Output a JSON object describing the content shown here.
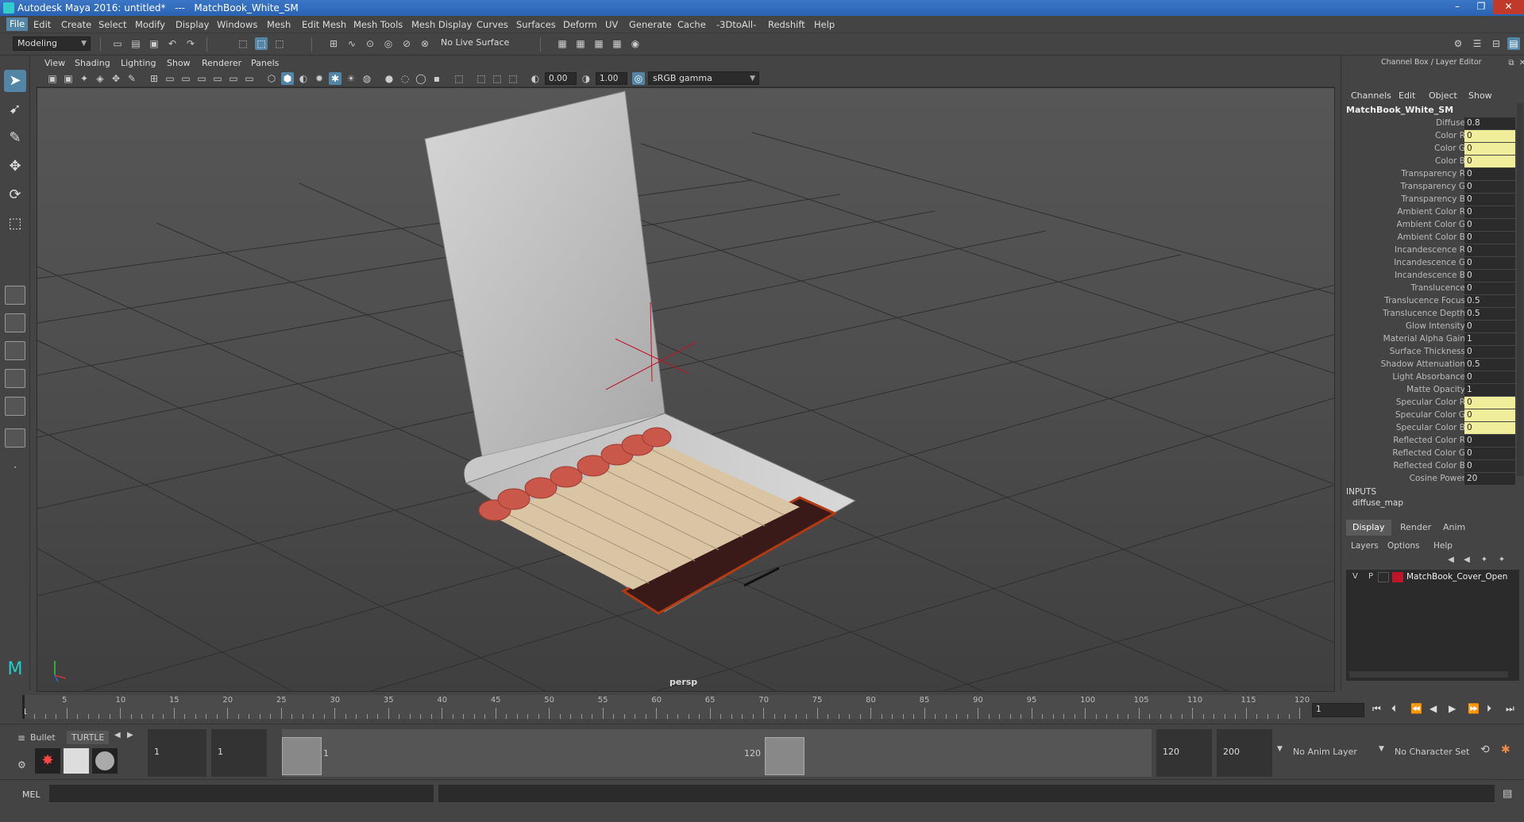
{
  "window": {
    "title": "Autodesk Maya 2016: untitled*   ---   MatchBook_White_SM",
    "min": "–",
    "max": "❐",
    "close": "✕"
  },
  "menubar": [
    "File",
    "Edit",
    "Create",
    "Select",
    "Modify",
    "Display",
    "Windows",
    "Mesh",
    "Edit Mesh",
    "Mesh Tools",
    "Mesh Display",
    "Curves",
    "Surfaces",
    "Deform",
    "UV",
    "Generate",
    "Cache",
    "-3DtoAll-",
    "Redshift",
    "Help"
  ],
  "statusline": {
    "mode": "Modeling",
    "live_surface": "No Live Surface"
  },
  "viewport": {
    "menu": [
      "View",
      "Shading",
      "Lighting",
      "Show",
      "Renderer",
      "Panels"
    ],
    "exposure": "0.00",
    "gamma": "1.00",
    "colorspace": "sRGB gamma",
    "camera": "persp"
  },
  "channelbox": {
    "title": "Channel Box / Layer Editor",
    "menu": [
      "Channels",
      "Edit",
      "Object",
      "Show"
    ],
    "object": "MatchBook_White_SM",
    "attributes": [
      {
        "label": "Diffuse",
        "value": "0.8",
        "hl": false
      },
      {
        "label": "Color R",
        "value": "0",
        "hl": true
      },
      {
        "label": "Color G",
        "value": "0",
        "hl": true
      },
      {
        "label": "Color B",
        "value": "0",
        "hl": true
      },
      {
        "label": "Transparency R",
        "value": "0",
        "hl": false
      },
      {
        "label": "Transparency G",
        "value": "0",
        "hl": false
      },
      {
        "label": "Transparency B",
        "value": "0",
        "hl": false
      },
      {
        "label": "Ambient Color R",
        "value": "0",
        "hl": false
      },
      {
        "label": "Ambient Color G",
        "value": "0",
        "hl": false
      },
      {
        "label": "Ambient Color B",
        "value": "0",
        "hl": false
      },
      {
        "label": "Incandescence R",
        "value": "0",
        "hl": false
      },
      {
        "label": "Incandescence G",
        "value": "0",
        "hl": false
      },
      {
        "label": "Incandescence B",
        "value": "0",
        "hl": false
      },
      {
        "label": "Translucence",
        "value": "0",
        "hl": false
      },
      {
        "label": "Translucence Focus",
        "value": "0.5",
        "hl": false
      },
      {
        "label": "Translucence Depth",
        "value": "0.5",
        "hl": false
      },
      {
        "label": "Glow Intensity",
        "value": "0",
        "hl": false
      },
      {
        "label": "Material Alpha Gain",
        "value": "1",
        "hl": false
      },
      {
        "label": "Surface Thickness",
        "value": "0",
        "hl": false
      },
      {
        "label": "Shadow Attenuation",
        "value": "0.5",
        "hl": false
      },
      {
        "label": "Light Absorbance",
        "value": "0",
        "hl": false
      },
      {
        "label": "Matte Opacity",
        "value": "1",
        "hl": false
      },
      {
        "label": "Specular Color R",
        "value": "0",
        "hl": true
      },
      {
        "label": "Specular Color G",
        "value": "0",
        "hl": true
      },
      {
        "label": "Specular Color B",
        "value": "0",
        "hl": true
      },
      {
        "label": "Reflected Color R",
        "value": "0",
        "hl": false
      },
      {
        "label": "Reflected Color G",
        "value": "0",
        "hl": false
      },
      {
        "label": "Reflected Color B",
        "value": "0",
        "hl": false
      },
      {
        "label": "Cosine Power",
        "value": "20",
        "hl": false
      }
    ],
    "inputs_label": "INPUTS",
    "inputs_item": "diffuse_map"
  },
  "layereditor": {
    "tabs": [
      "Display",
      "Render",
      "Anim"
    ],
    "menu": [
      "Layers",
      "Options",
      "Help"
    ],
    "layer": {
      "v": "V",
      "p": "P",
      "name": "MatchBook_Cover_Open",
      "color": "#c0142a"
    }
  },
  "timeslider": {
    "ticks": [
      "1",
      "5",
      "10",
      "15",
      "20",
      "25",
      "30",
      "35",
      "40",
      "45",
      "50",
      "55",
      "60",
      "65",
      "70",
      "75",
      "80",
      "85",
      "90",
      "95",
      "100",
      "105",
      "110",
      "115",
      "120"
    ],
    "current_frame": "1"
  },
  "rangeslider": {
    "shelf_tabs": [
      "Bullet",
      "TURTLE"
    ],
    "start": "1",
    "playback_start": "1",
    "range_start_label": "1",
    "range_end_label": "120",
    "playback_end": "120",
    "end": "200",
    "anim_layer": "No Anim Layer",
    "character_set": "No Character Set"
  },
  "cmdline": {
    "label": "MEL"
  }
}
